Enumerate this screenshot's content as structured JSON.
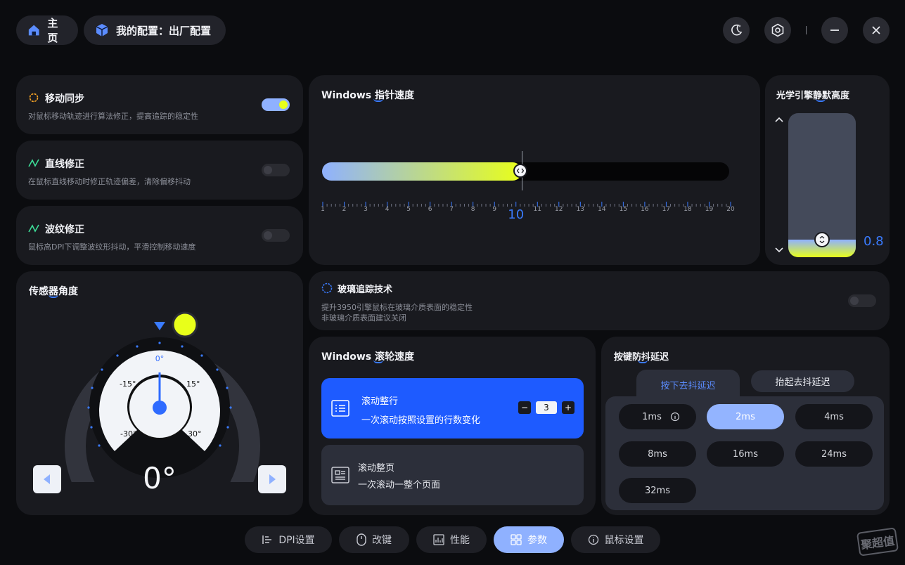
{
  "header": {
    "home_label": "主页",
    "config_label": "我的配置：出厂配置"
  },
  "motion_sync": {
    "title": "移动同步",
    "desc": "对鼠标移动轨迹进行算法修正，提高追踪的稳定性",
    "enabled": true
  },
  "line_correction": {
    "title": "直线修正",
    "desc": "在鼠标直线移动时修正轨迹偏差，清除偏移抖动",
    "enabled": false
  },
  "ripple_correction": {
    "title": "波纹修正",
    "desc": "鼠标高DPI下调整波纹形抖动，平滑控制移动速度",
    "enabled": false
  },
  "pointer_speed": {
    "title": "Windows 指针速度",
    "value": "10",
    "min": 1,
    "max": 20,
    "current": 10,
    "ticks": [
      "1",
      "2",
      "3",
      "4",
      "5",
      "6",
      "7",
      "8",
      "9",
      "10",
      "11",
      "12",
      "13",
      "14",
      "15",
      "16",
      "17",
      "18",
      "19",
      "20"
    ]
  },
  "lod": {
    "title": "光学引擎静默高度",
    "value": "0.8",
    "level": 0.12
  },
  "sensor_angle": {
    "title": "传感器角度",
    "value": "0°",
    "dial_labels": {
      "top": "0°",
      "l15": "-15°",
      "r15": "15°",
      "l30": "-30°",
      "r30": "30°"
    }
  },
  "glass_tracking": {
    "title": "玻璃追踪技术",
    "desc1": "提升3950引擎鼠标在玻璃介质表面的稳定性",
    "desc2": "非玻璃介质表面建议关闭",
    "enabled": false
  },
  "scroll_speed": {
    "title": "Windows 滚轮速度",
    "line_mode": {
      "title": "滚动整行",
      "desc": "一次滚动按照设置的行数变化",
      "value": "3"
    },
    "page_mode": {
      "title": "滚动整页",
      "desc": "一次滚动一整个页面"
    }
  },
  "debounce": {
    "title": "按键防抖延迟",
    "tab_press": "按下去抖延迟",
    "tab_release": "抬起去抖延迟",
    "options": [
      "1ms",
      "2ms",
      "4ms",
      "8ms",
      "16ms",
      "24ms",
      "32ms"
    ],
    "selected": "2ms"
  },
  "nav": {
    "dpi": "DPI设置",
    "remap": "改键",
    "performance": "性能",
    "params": "参数",
    "mouse_settings": "鼠标设置"
  },
  "watermark": "聚超值",
  "colors": {
    "accent_blue": "#1e5bff",
    "accent_light": "#8fb1ff",
    "lime": "#e8ff1a",
    "card": "#191a1f"
  }
}
